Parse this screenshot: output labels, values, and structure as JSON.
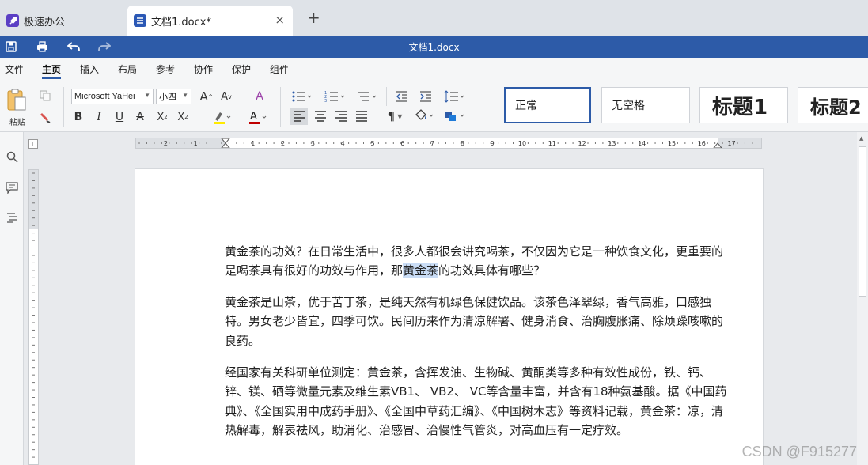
{
  "tabs": {
    "home": {
      "label": "极速办公"
    },
    "doc": {
      "label": "文档1.docx*"
    },
    "close_glyph": "×",
    "new_tab_glyph": "+"
  },
  "titlebar": {
    "title": "文档1.docx",
    "color": "#2d5ba8"
  },
  "menu": [
    "文件",
    "主页",
    "插入",
    "布局",
    "参考",
    "协作",
    "保护",
    "组件"
  ],
  "menu_active": "主页",
  "ribbon": {
    "paste_label": "粘贴",
    "font_name": "Microsoft YaHei",
    "font_size": "小四",
    "styles": [
      "正常",
      "无空格",
      "标题1",
      "标题2"
    ],
    "selected_style": "正常"
  },
  "ruler": {
    "tab_marker": "L",
    "h_labels_left": [
      "2",
      "1"
    ],
    "h_labels_right": [
      "1",
      "2",
      "3",
      "4",
      "5",
      "6",
      "7",
      "8",
      "9",
      "10",
      "11",
      "12",
      "13",
      "14",
      "15",
      "16",
      "17"
    ]
  },
  "document": {
    "paragraphs": [
      {
        "before": "黄金茶的功效？在日常生活中，很多人都很会讲究喝茶，不仅因为它是一种饮食文化，更重要的是喝茶具有很好的功效与作用，那",
        "highlight": "黄金茶",
        "after": "的功效具体有哪些？"
      },
      {
        "before": "黄金茶是山茶，优于苦丁茶，是纯天然有机绿色保健饮品。该茶色泽翠绿，香气高雅，口感独特。男女老少皆宜，四季可饮。民间历来作为清凉解署、健身消食、治胸腹胀痛、除烦躁咳嗽的良药。",
        "highlight": "",
        "after": ""
      },
      {
        "before": "经国家有关科研单位测定：黄金茶，含挥发油、生物碱、黄酮类等多种有效性成份，铁、钙、锌、镁、硒等微量元素及维生素VB1、 VB2、 VC等含量丰富，并含有18种氨基酸。据《中国药典》、《全国实用中成药手册》、《全国中草药汇编》、《中国树木志》等资料记载，黄金茶：凉，清热解毒，解表祛风，助消化、治感冒、治慢性气管炎，对高血压有一定疗效。",
        "highlight": "",
        "after": ""
      }
    ]
  },
  "watermark": "CSDN @F915277"
}
